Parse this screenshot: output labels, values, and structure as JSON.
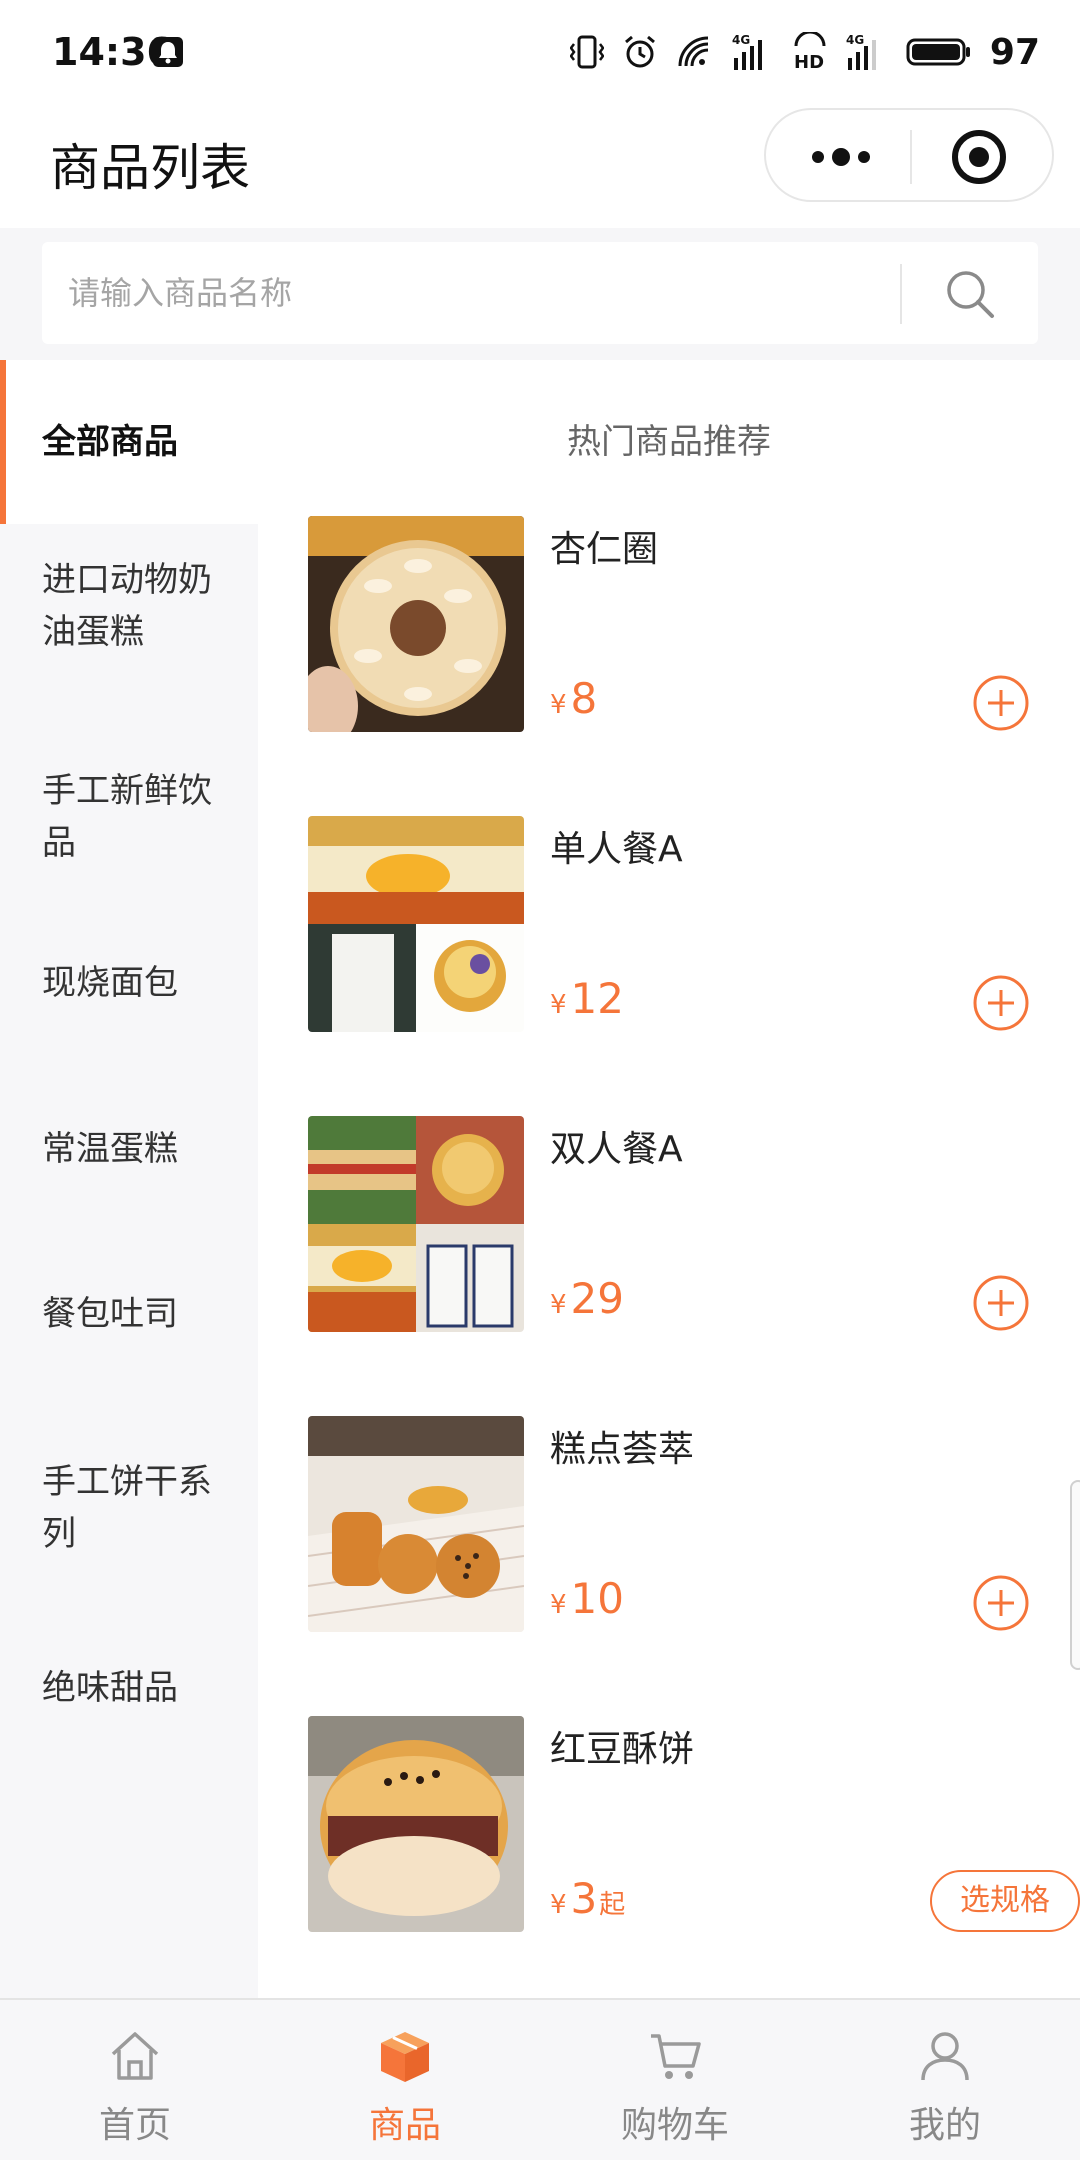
{
  "status_bar": {
    "time": "14:36",
    "network_label": "4G",
    "battery": "97"
  },
  "nav": {
    "title": "商品列表"
  },
  "search": {
    "placeholder": "请输入商品名称"
  },
  "sidebar": {
    "items": [
      {
        "label": "全部商品",
        "active": true
      },
      {
        "label": "进口动物奶油蛋糕",
        "active": false
      },
      {
        "label": "手工新鲜饮品",
        "active": false
      },
      {
        "label": "现烧面包",
        "active": false
      },
      {
        "label": "常温蛋糕",
        "active": false
      },
      {
        "label": "餐包吐司",
        "active": false
      },
      {
        "label": "手工饼干系列",
        "active": false
      },
      {
        "label": "绝味甜品",
        "active": false
      }
    ]
  },
  "content": {
    "section_title": "热门商品推荐",
    "products": [
      {
        "name": "杏仁圈",
        "currency": "¥",
        "price": "8",
        "price_suffix": "",
        "action": "add"
      },
      {
        "name": "单人餐A",
        "currency": "¥",
        "price": "12",
        "price_suffix": "",
        "action": "add"
      },
      {
        "name": "双人餐A",
        "currency": "¥",
        "price": "29",
        "price_suffix": "",
        "action": "add"
      },
      {
        "name": "糕点荟萃",
        "currency": "¥",
        "price": "10",
        "price_suffix": "",
        "action": "add"
      },
      {
        "name": "红豆酥饼",
        "currency": "¥",
        "price": "3",
        "price_suffix": "起",
        "action": "spec",
        "action_label": "选规格"
      }
    ]
  },
  "tab_bar": {
    "tabs": [
      {
        "label": "首页",
        "icon": "home-icon",
        "active": false
      },
      {
        "label": "商品",
        "icon": "box-icon",
        "active": true
      },
      {
        "label": "购物车",
        "icon": "cart-icon",
        "active": false
      },
      {
        "label": "我的",
        "icon": "user-icon",
        "active": false
      }
    ]
  },
  "colors": {
    "accent": "#f5753a",
    "background": "#f7f7f9"
  }
}
